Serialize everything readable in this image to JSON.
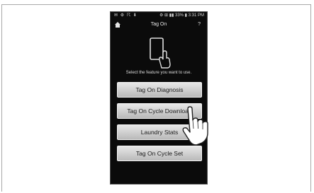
{
  "status_bar": {
    "left_icons": "✉ ⚙ ☈ ⬇",
    "right_text": "⚙ ⊞ ▮▮ 33% ▮ 3:31 PM"
  },
  "app_bar": {
    "title": "Tag On",
    "help_label": "?"
  },
  "instruction": "Select the feature you want to use.",
  "menu": {
    "items": [
      {
        "label": "Tag On Diagnosis"
      },
      {
        "label": "Tag On Cycle Download"
      },
      {
        "label": "Laundry Stats"
      },
      {
        "label": "Tag On Cycle Set"
      }
    ]
  },
  "icons": {
    "home": "home-icon",
    "help": "help-icon",
    "device": "phone-tap-icon",
    "pointer": "hand-pointer-icon"
  },
  "colors": {
    "screen_background": "#0b0b0b",
    "button_face": "#d0d0d0",
    "text_light": "#e6e6e6"
  }
}
